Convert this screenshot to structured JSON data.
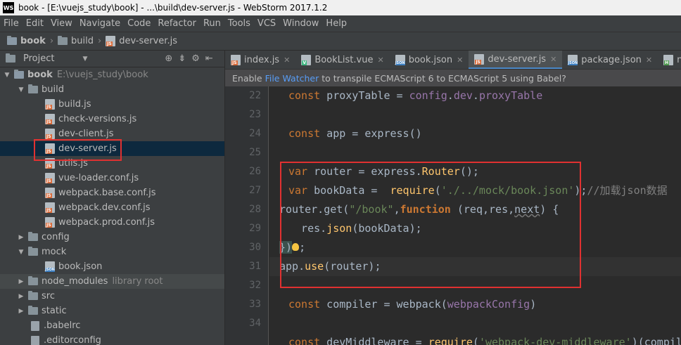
{
  "window": {
    "title": "book - [E:\\vuejs_study\\book] - ...\\build\\dev-server.js - WebStorm 2017.1.2",
    "logo": "WS"
  },
  "menu": [
    "File",
    "Edit",
    "View",
    "Navigate",
    "Code",
    "Refactor",
    "Run",
    "Tools",
    "VCS",
    "Window",
    "Help"
  ],
  "breadcrumb": [
    "book",
    "build",
    "dev-server.js"
  ],
  "project_panel": {
    "label": "Project"
  },
  "tree": [
    {
      "label": "book",
      "extra": "E:\\vuejs_study\\book",
      "type": "root",
      "expanded": true,
      "depth": 0
    },
    {
      "label": "build",
      "type": "folder",
      "expanded": true,
      "depth": 1
    },
    {
      "label": "build.js",
      "type": "js",
      "depth": 2
    },
    {
      "label": "check-versions.js",
      "type": "js",
      "depth": 2
    },
    {
      "label": "dev-client.js",
      "type": "js",
      "depth": 2
    },
    {
      "label": "dev-server.js",
      "type": "js",
      "depth": 2,
      "selected": true
    },
    {
      "label": "utils.js",
      "type": "js",
      "depth": 2
    },
    {
      "label": "vue-loader.conf.js",
      "type": "js",
      "depth": 2
    },
    {
      "label": "webpack.base.conf.js",
      "type": "js",
      "depth": 2
    },
    {
      "label": "webpack.dev.conf.js",
      "type": "js",
      "depth": 2
    },
    {
      "label": "webpack.prod.conf.js",
      "type": "js",
      "depth": 2
    },
    {
      "label": "config",
      "type": "folder",
      "expanded": false,
      "depth": 1
    },
    {
      "label": "mock",
      "type": "folder",
      "expanded": true,
      "depth": 1
    },
    {
      "label": "book.json",
      "type": "json",
      "depth": 2
    },
    {
      "label": "node_modules",
      "extra": "library root",
      "type": "folder",
      "expanded": false,
      "depth": 1
    },
    {
      "label": "src",
      "type": "folder",
      "expanded": false,
      "depth": 1
    },
    {
      "label": "static",
      "type": "folder",
      "expanded": false,
      "depth": 1
    },
    {
      "label": ".babelrc",
      "type": "cfg",
      "depth": 1
    },
    {
      "label": ".editorconfig",
      "type": "cfg",
      "depth": 1
    }
  ],
  "tabs": [
    {
      "label": "index.js",
      "type": "js"
    },
    {
      "label": "BookList.vue",
      "type": "vue"
    },
    {
      "label": "book.json",
      "type": "json"
    },
    {
      "label": "dev-server.js",
      "type": "js",
      "active": true
    },
    {
      "label": "package.json",
      "type": "json"
    },
    {
      "label": "navBrea",
      "type": "html"
    }
  ],
  "banner": {
    "before": "Enable",
    "link": "File Watcher",
    "after": "to transpile ECMAScript 6 to ECMAScript 5 using Babel?"
  },
  "line_numbers": [
    "22",
    "23",
    "24",
    "25",
    "26",
    "27",
    "28",
    "29",
    "30",
    "31",
    "32",
    "33",
    "34"
  ],
  "code": {
    "l22": {
      "kw": "const",
      "a": " proxyTable = ",
      "p1": "config",
      "d": ".",
      "p2": "dev",
      "d2": ".",
      "p3": "proxyTable"
    },
    "l24": {
      "kw": "const",
      "a": " app = express()"
    },
    "l26": {
      "kw": "var",
      "a": " router = express.",
      "fn": "Router",
      "b": "();"
    },
    "l27": {
      "kw": "var",
      "a": " bookData =  ",
      "fn": "require",
      "b": "(",
      "s": "'./../mock/book.json'",
      "c": ");",
      "cm": "//加载json数据"
    },
    "l28": {
      "a": "router.get(",
      "s": "\"/book\"",
      "b": ",",
      "kw": "function",
      "c": " (req,res,",
      "u": "next",
      "d": ") {"
    },
    "l29": {
      "a": "  res.",
      "fn": "json",
      "b": "(bookData);"
    },
    "l30": {
      "a": "})",
      "b": ";"
    },
    "l31": {
      "a": "app.",
      "fn": "use",
      "b": "(router);"
    },
    "l33": {
      "kw": "const",
      "a": " compiler = webpack(",
      "p": "webpackConfig",
      "b": ")"
    },
    "l35": {
      "kw": "const",
      "a": " devMiddleware = ",
      "fn": "require",
      "b": "(",
      "s": "'webpack-dev-middleware'",
      "c": ")(compil"
    }
  }
}
